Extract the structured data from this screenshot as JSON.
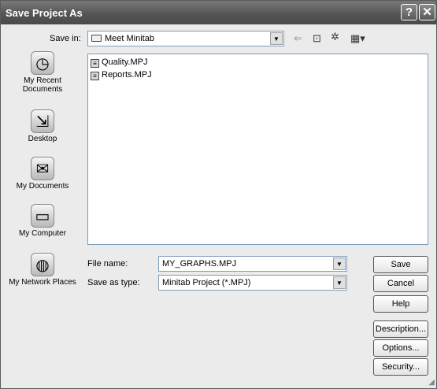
{
  "window": {
    "title": "Save Project As"
  },
  "titlebar": {
    "help_glyph": "?",
    "close_glyph": "✕"
  },
  "save_in": {
    "label": "Save in:",
    "value": "Meet Minitab",
    "folder_icon": "folder-icon"
  },
  "toolbar": {
    "back_icon": "back-arrow-icon",
    "up_icon": "up-folder-icon",
    "new_folder_icon": "new-folder-icon",
    "views_icon": "views-menu-icon"
  },
  "places": [
    {
      "label": "My Recent Documents",
      "icon": "recent-documents-icon"
    },
    {
      "label": "Desktop",
      "icon": "desktop-icon"
    },
    {
      "label": "My Documents",
      "icon": "my-documents-icon"
    },
    {
      "label": "My Computer",
      "icon": "my-computer-icon"
    },
    {
      "label": "My Network Places",
      "icon": "network-places-icon"
    }
  ],
  "files": [
    {
      "name": "Quality.MPJ",
      "icon": "minitab-project-file-icon"
    },
    {
      "name": "Reports.MPJ",
      "icon": "minitab-project-file-icon"
    }
  ],
  "file_name": {
    "label": "File name:",
    "value": "MY_GRAPHS.MPJ"
  },
  "save_as_type": {
    "label": "Save as type:",
    "value": "Minitab Project (*.MPJ)"
  },
  "buttons": {
    "save": "Save",
    "cancel": "Cancel",
    "help": "Help",
    "description": "Description...",
    "options": "Options...",
    "security": "Security..."
  }
}
